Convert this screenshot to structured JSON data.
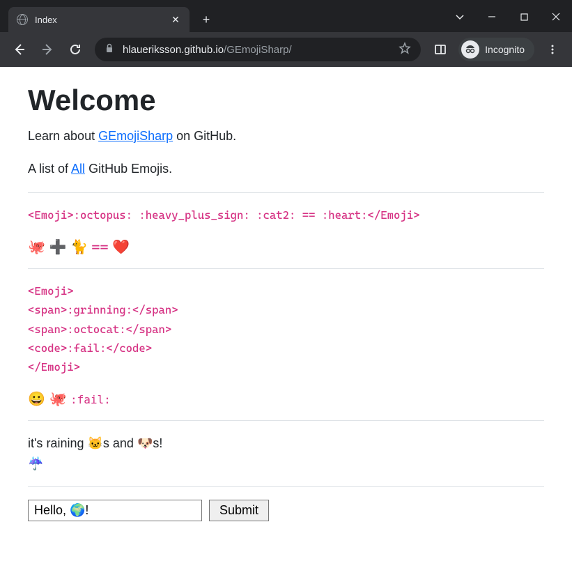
{
  "browser": {
    "tab_title": "Index",
    "url_host": "hlaueriksson.github.io",
    "url_path": "/GEmojiSharp/",
    "incognito_label": "Incognito"
  },
  "page": {
    "heading": "Welcome",
    "intro_prefix": "Learn about ",
    "intro_link": "GEmojiSharp",
    "intro_suffix": " on GitHub.",
    "list_prefix": "A list of ",
    "list_link": "All",
    "list_suffix": " GitHub Emojis.",
    "code1": "<Emoji>:octopus: :heavy_plus_sign: :cat2: == :heart:</Emoji>",
    "emoji_row1_octopus": "🐙",
    "emoji_row1_plus": "➕",
    "emoji_row1_cat": "🐈",
    "emoji_row1_eq": "==",
    "emoji_row1_heart": "❤️",
    "code2": "<Emoji>\n<span>:grinning:</span>\n<span>:octocat:</span>\n<code>:fail:</code>\n</Emoji>",
    "emoji_row2_grinning": "😀",
    "emoji_row2_octocat": "🐙",
    "emoji_row2_fail": ":fail:",
    "raining_text_1": "it's raining ",
    "raining_cat": "🐱",
    "raining_text_2": "s and ",
    "raining_dog": "🐶",
    "raining_text_3": "s!",
    "raining_umbrella": "☔",
    "input_value": "Hello, 🌍!",
    "submit_label": "Submit"
  }
}
